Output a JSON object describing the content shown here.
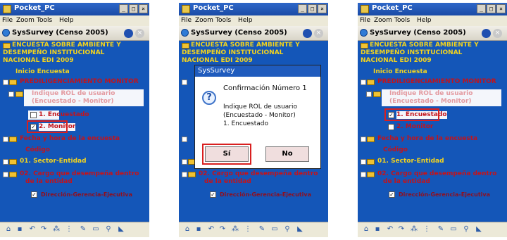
{
  "window": {
    "title": "Pocket_PC",
    "buttons": {
      "minimize": "_",
      "maximize": "□",
      "close": "×"
    }
  },
  "menu": [
    "File",
    "Zoom",
    "Tools",
    "Help"
  ],
  "app": {
    "title": "SysSurvey (Censo 2005)"
  },
  "tree": {
    "survey_title_1": "ENCUESTA SOBRE AMBIENTE Y",
    "survey_title_2": "DESEMPEÑO INSTITUCIONAL",
    "survey_title_3": "NACIONAL EDI 2009",
    "inicio": "Inicio Encuesta",
    "section": "PREDILIGENCIAMIENTO MONITOR",
    "question_1": "Indique ROL de usuario",
    "question_2": "(Encuestado - Monitor)",
    "option_1": "1. Encuestado",
    "option_2": "2. Monitor",
    "fecha": "Fecha y hora de la encuesta",
    "codigo": "Código",
    "sector": "01. Sector-Entidad",
    "cargo_1": "02. Cargo que desempeña dentro",
    "cargo_2": "de la entidad",
    "direccion": "Dirección-Gerencia-Ejecutiva"
  },
  "dialog": {
    "title": "SysSurvey",
    "heading": "Confirmación Número 1",
    "line1": "Indique ROL de usuario",
    "line2": "(Encuestado - Monitor)",
    "line3": "1. Encuestado",
    "yes_label": "Sí",
    "no_label": "No"
  },
  "colors": {
    "tree_bg": "#1456b8",
    "highlight": "#d91f1f",
    "yellow_text": "#f3d31e",
    "red_text": "#c2141c"
  },
  "screens": [
    {
      "id": "screen-1",
      "selected_option": "option_2",
      "dialog": false
    },
    {
      "id": "screen-2",
      "selected_option": "none",
      "dialog": true
    },
    {
      "id": "screen-3",
      "selected_option": "option_1",
      "dialog": false
    }
  ]
}
